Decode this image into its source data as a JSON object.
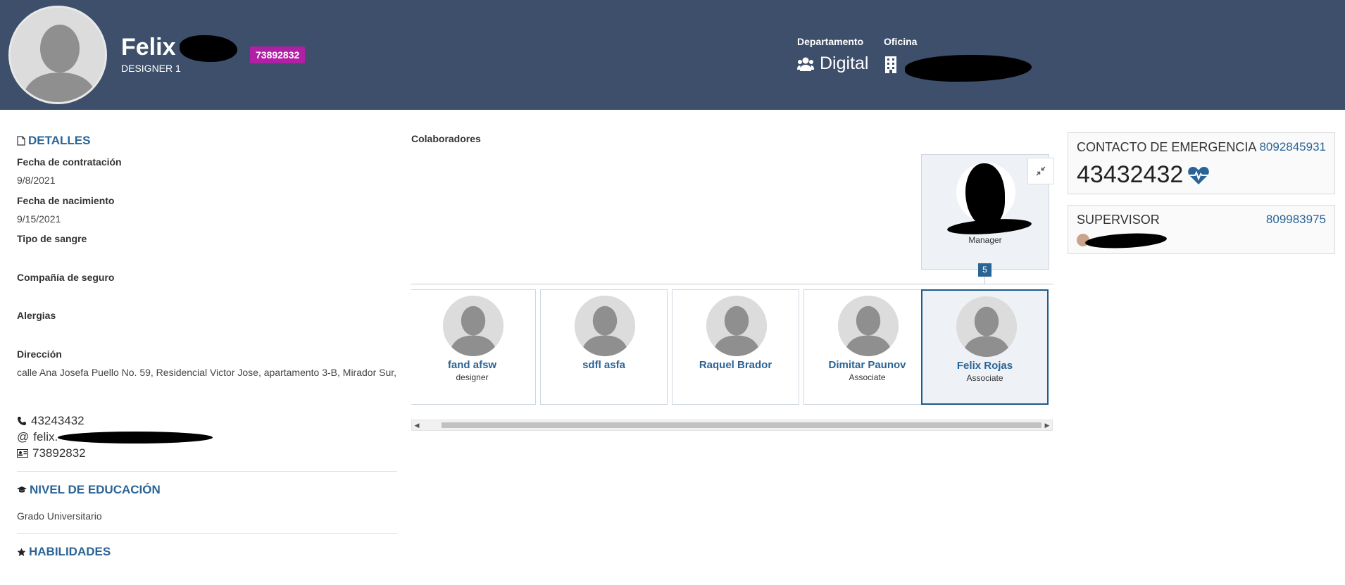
{
  "header": {
    "name": "Felix",
    "job_title": "DESIGNER 1",
    "employee_id": "73892832",
    "department_label": "Departamento",
    "department_value": "Digital",
    "office_label": "Oficina",
    "icons": [
      "avatar-icon",
      "group-icon",
      "building-icon"
    ]
  },
  "details": {
    "section_title": "DETALLES",
    "hire_date_label": "Fecha de contratación",
    "hire_date": "9/8/2021",
    "birth_date_label": "Fecha de nacimiento",
    "birth_date": "9/15/2021",
    "blood_type_label": "Tipo de sangre",
    "insurance_label": "Compañía de seguro",
    "allergies_label": "Alergias",
    "address_label": "Dirección",
    "address": "calle Ana Josefa Puello No. 59, Residencial Victor Jose, apartamento 3-B, Mirador Sur,",
    "phone": "43243432",
    "email_prefix": "felix.",
    "id_card": "73892832"
  },
  "education": {
    "section_title": "NIVEL DE EDUCACIÓN",
    "level": "Grado Universitario"
  },
  "skills": {
    "section_title": "HABILIDADES"
  },
  "collaborators": {
    "title": "Colaboradores",
    "manager_role": "Manager",
    "count": "5",
    "people": [
      {
        "name": "fand afsw",
        "role": "designer"
      },
      {
        "name": "sdfl asfa",
        "role": ""
      },
      {
        "name": "Raquel Brador",
        "role": ""
      },
      {
        "name": "Dimitar Paunov",
        "role": "Associate"
      },
      {
        "name": "Felix Rojas",
        "role": "Associate",
        "selected": true
      }
    ]
  },
  "emergency": {
    "label": "CONTACTO DE EMERGENCIA",
    "phone": "8092845931",
    "number": "43432432"
  },
  "supervisor": {
    "label": "SUPERVISOR",
    "phone": "809983975"
  },
  "colors": {
    "header_bg": "#3d4f6b",
    "badge": "#b11fa5",
    "link_blue": "#2a6496"
  }
}
